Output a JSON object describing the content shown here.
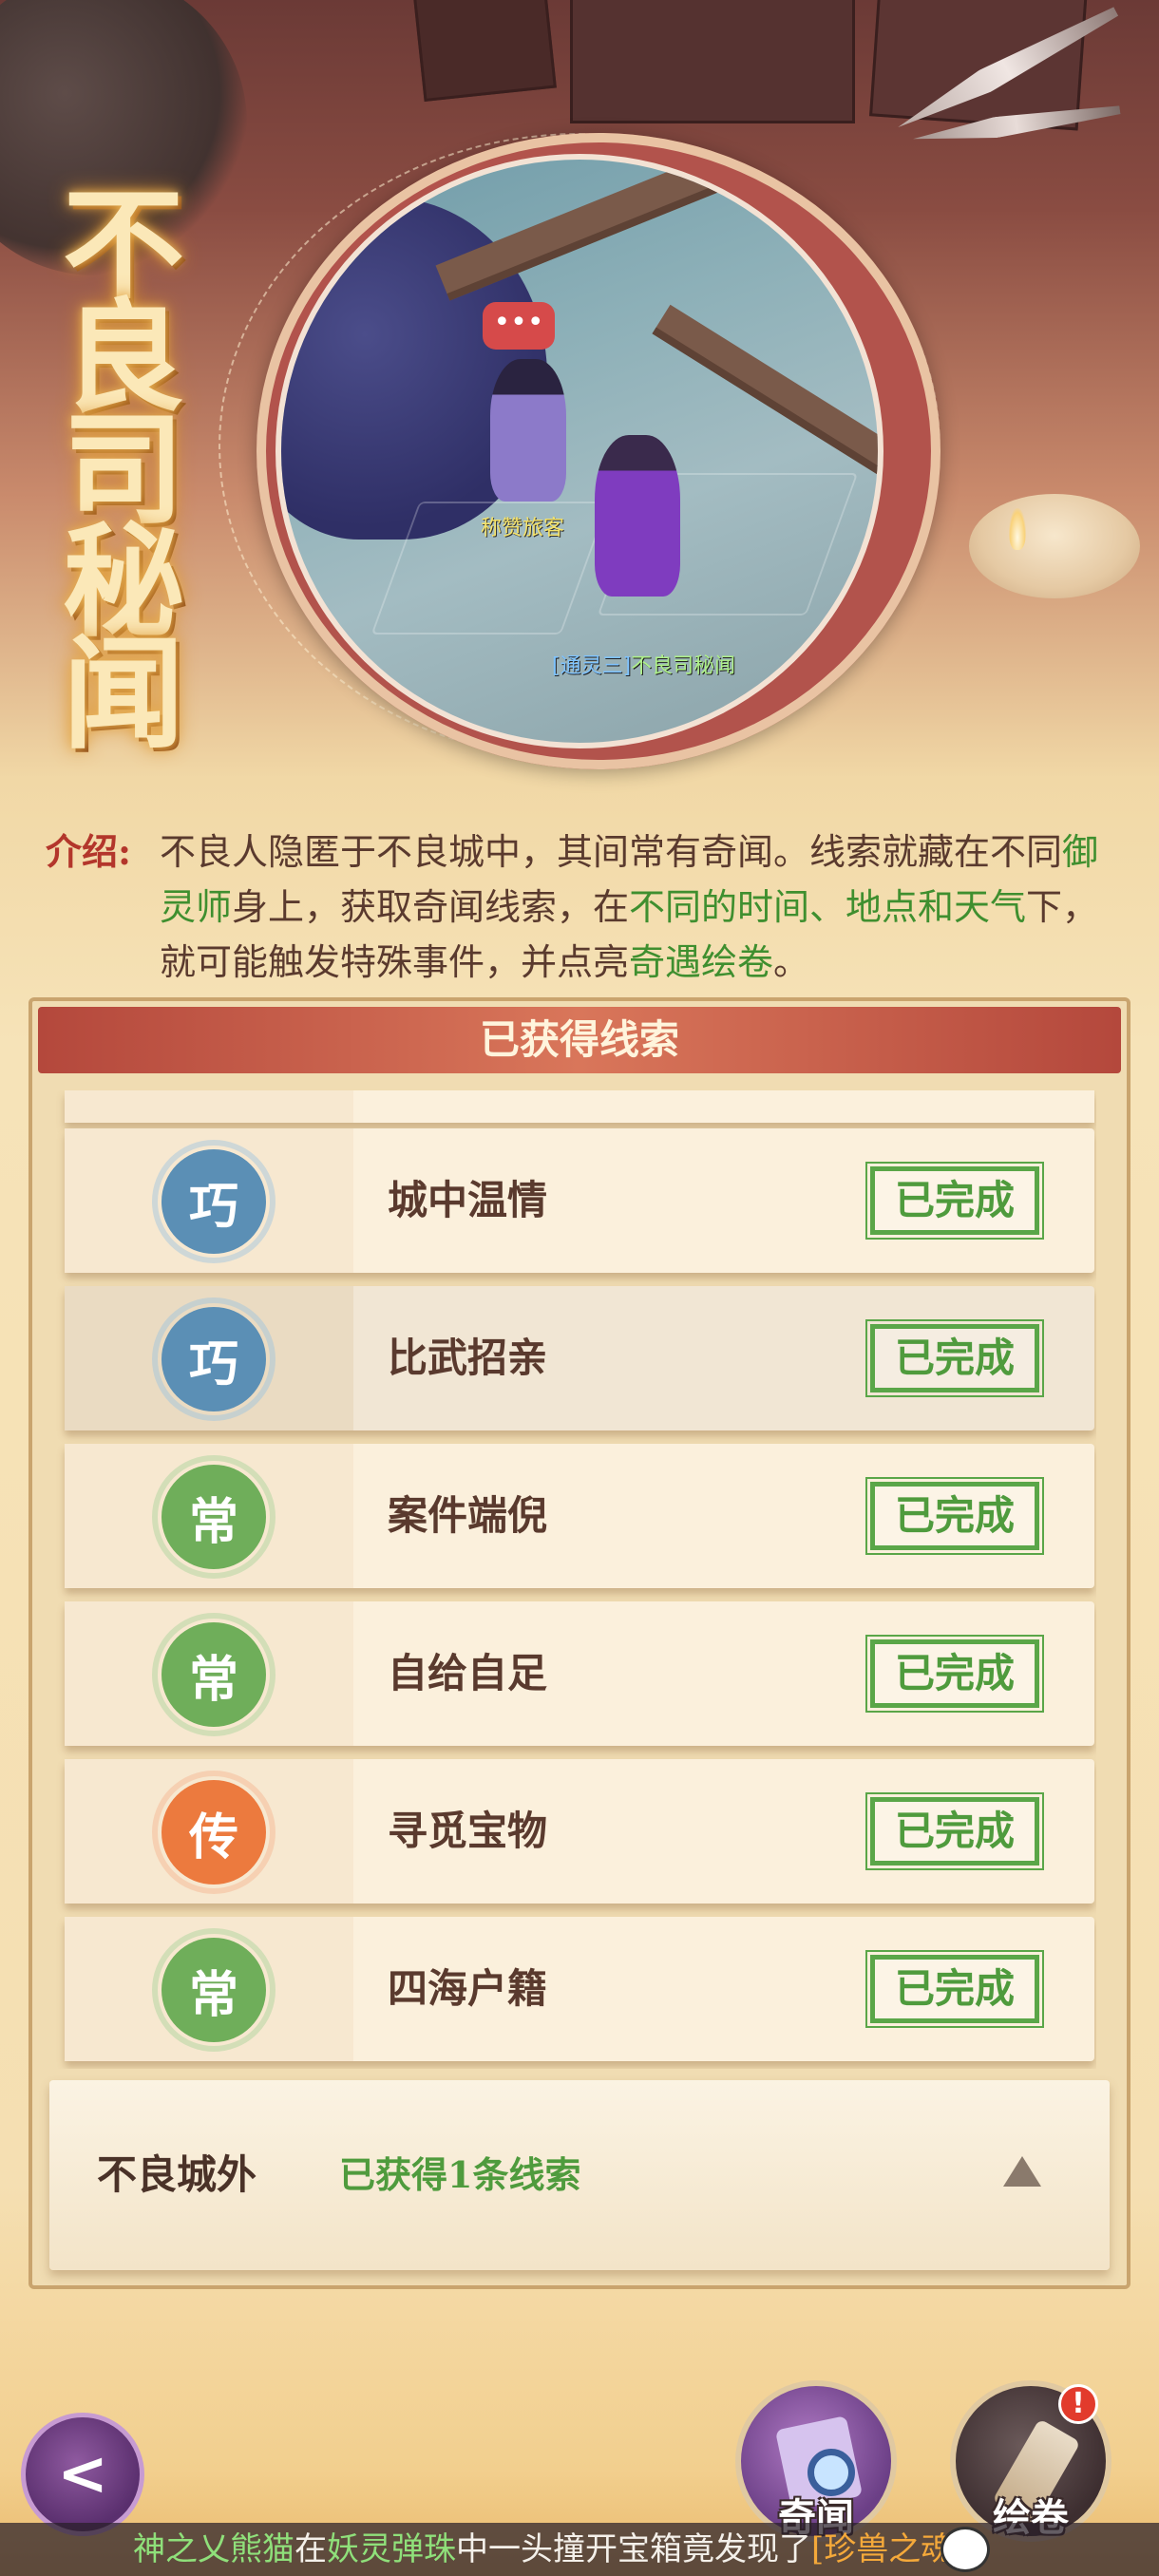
{
  "header": {
    "title": "不良司秘闻",
    "npc_bubble": "•••",
    "npc_name": "称赞旅客",
    "player_tag": "[通灵三]",
    "player_name": "不良司秘闻"
  },
  "intro": {
    "label": "介绍:",
    "segments": [
      {
        "text": "不良人隐匿于不良城中，其间常有奇闻。线索就藏在不同",
        "hl": false
      },
      {
        "text": "御灵师",
        "hl": true
      },
      {
        "text": "身上，获取奇闻线索，在",
        "hl": false
      },
      {
        "text": "不同的时间、地点和天气",
        "hl": true
      },
      {
        "text": "下，就可能触发特殊事件，并点亮",
        "hl": false
      },
      {
        "text": "奇遇绘卷",
        "hl": true
      },
      {
        "text": "。",
        "hl": false
      }
    ]
  },
  "panel": {
    "title": "已获得线索"
  },
  "clues": [
    {
      "badge": "巧",
      "type": "qiao",
      "name": "城中温情",
      "status": "已完成"
    },
    {
      "badge": "巧",
      "type": "qiao",
      "name": "比武招亲",
      "status": "已完成"
    },
    {
      "badge": "常",
      "type": "chang",
      "name": "案件端倪",
      "status": "已完成"
    },
    {
      "badge": "常",
      "type": "chang",
      "name": "自给自足",
      "status": "已完成"
    },
    {
      "badge": "传",
      "type": "chuan",
      "name": "寻觅宝物",
      "status": "已完成"
    },
    {
      "badge": "常",
      "type": "chang",
      "name": "四海户籍",
      "status": "已完成"
    }
  ],
  "outer_section": {
    "name": "不良城外",
    "count_text": "已获得1条线索"
  },
  "bottom": {
    "back_symbol": "<",
    "qiwen_label": "奇闻",
    "huijuan_label": "绘卷",
    "alert": "!"
  },
  "ticker": {
    "user": "神之乂熊猫",
    "t1": "在",
    "game": "妖灵弹珠",
    "t2": "中一头撞开宝箱竟发现了",
    "item": "[珍兽之魂]"
  },
  "colors": {
    "highlight_green": "#3f8f2f",
    "done_green": "#4f9b3d",
    "qiao_blue": "#5b8fb5",
    "chang_green": "#6fae5a",
    "chuan_orange": "#ec7a3e",
    "header_red": "#b4483c"
  }
}
